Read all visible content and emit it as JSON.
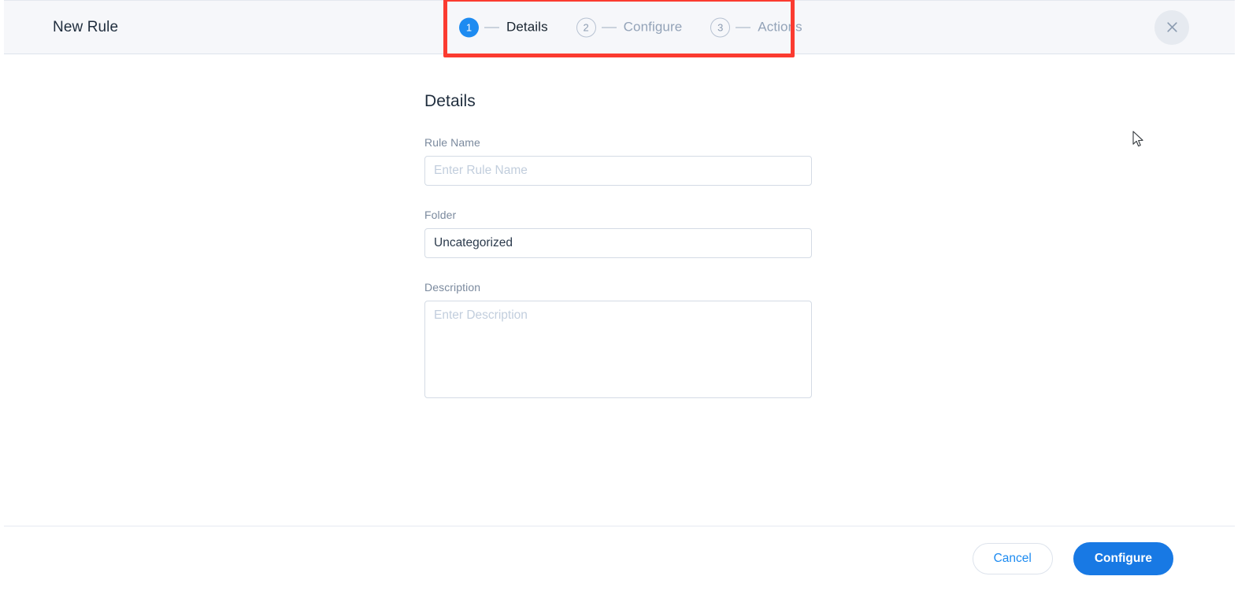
{
  "window": {
    "title": "New Rule",
    "close_icon": "close-icon"
  },
  "stepper": {
    "steps": [
      {
        "number": "1",
        "label": "Details",
        "state": "active"
      },
      {
        "number": "2",
        "label": "Configure",
        "state": "inactive"
      },
      {
        "number": "3",
        "label": "Actions",
        "state": "inactive"
      }
    ]
  },
  "annotation": {
    "color": "#fb3b30",
    "target": "stepper"
  },
  "form": {
    "section_title": "Details",
    "fields": [
      {
        "label": "Rule Name",
        "value": "",
        "placeholder": "Enter Rule Name",
        "type": "text"
      },
      {
        "label": "Folder",
        "value": "Uncategorized",
        "placeholder": "",
        "type": "text"
      },
      {
        "label": "Description",
        "value": "",
        "placeholder": "Enter Description",
        "type": "textarea"
      }
    ]
  },
  "footer": {
    "cancel_label": "Cancel",
    "configure_label": "Configure"
  },
  "colors": {
    "accent": "#1d8bf1",
    "primary_button": "#1879e4",
    "header_bg": "#f6f7fa",
    "annotation": "#fb3b30",
    "label_text": "#7b8a9e",
    "placeholder": "#c2cedd"
  }
}
